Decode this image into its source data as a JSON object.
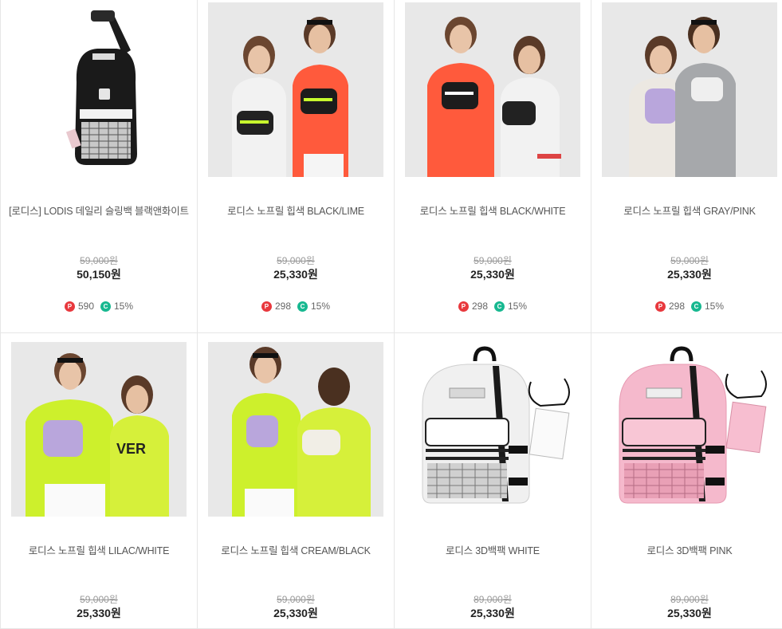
{
  "products": [
    {
      "name": "[로디스] LODIS 데일리 슬링백 블랙앤화이트",
      "original_price": "59,000원",
      "sale_price": "50,150원",
      "points": "590",
      "coupon": "15%",
      "image": "black-sling-bag"
    },
    {
      "name": "로디스 노프릴 힙색 BLACK/LIME",
      "original_price": "59,000원",
      "sale_price": "25,330원",
      "points": "298",
      "coupon": "15%",
      "image": "models-black-hipsack"
    },
    {
      "name": "로디스 노프릴 힙색 BLACK/WHITE",
      "original_price": "59,000원",
      "sale_price": "25,330원",
      "points": "298",
      "coupon": "15%",
      "image": "models-orange-hipsack"
    },
    {
      "name": "로디스 노프릴 힙색 GRAY/PINK",
      "original_price": "59,000원",
      "sale_price": "25,330원",
      "points": "298",
      "coupon": "15%",
      "image": "models-gray-hipsack"
    },
    {
      "name": "로디스 노프릴 힙색 LILAC/WHITE",
      "original_price": "59,000원",
      "sale_price": "25,330원",
      "image": "models-lime-lilac-hipsack"
    },
    {
      "name": "로디스 노프릴 힙색 CREAM/BLACK",
      "original_price": "59,000원",
      "sale_price": "25,330원",
      "image": "models-lime-cream-hipsack"
    },
    {
      "name": "로디스 3D백팩 WHITE",
      "original_price": "89,000원",
      "sale_price": "25,330원",
      "image": "white-backpack"
    },
    {
      "name": "로디스 3D백팩 PINK",
      "original_price": "89,000원",
      "sale_price": "25,330원",
      "image": "pink-backpack"
    }
  ],
  "badge_labels": {
    "point": "P",
    "coupon": "C"
  },
  "colors": {
    "point_badge": "#e8383d",
    "coupon_badge": "#17b890",
    "border": "#e6e6e6"
  }
}
